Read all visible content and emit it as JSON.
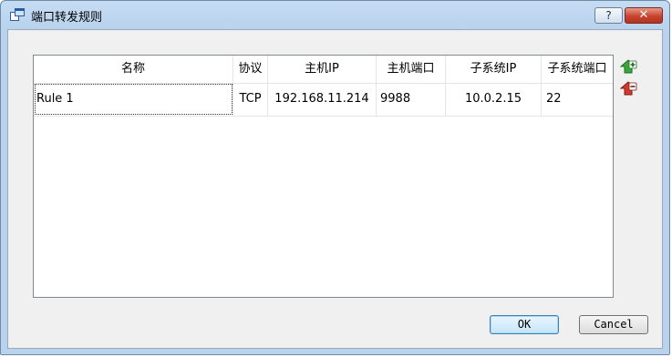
{
  "window": {
    "title": "端口转发规则",
    "help_label": "?",
    "close_label": "✕"
  },
  "table": {
    "columns": [
      "名称",
      "协议",
      "主机IP",
      "主机端口",
      "子系统IP",
      "子系统端口"
    ],
    "rows": [
      [
        "Rule 1",
        "TCP",
        "192.168.11.214",
        "9988",
        "10.0.2.15",
        "22"
      ]
    ]
  },
  "side_buttons": {
    "add_icon": "add-rule-icon",
    "remove_icon": "remove-rule-icon"
  },
  "buttons": {
    "ok_label": "OK",
    "cancel_label": "Cancel"
  },
  "colors": {
    "frame": "#b9d3ee",
    "close": "#c7432d",
    "add_green": "#3aa53a",
    "remove_red": "#d23a2a"
  }
}
